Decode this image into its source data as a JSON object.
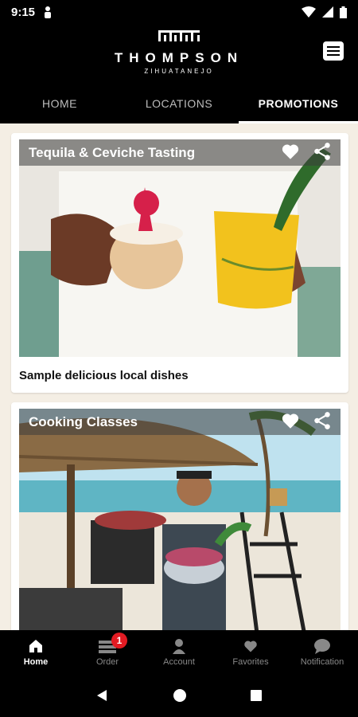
{
  "status": {
    "time": "9:15"
  },
  "header": {
    "logo_mark": "ꞌ⊓⊓ꞌ⊓⊓",
    "brand": "THOMPSON",
    "location": "ZIHUATANEJO",
    "menu_icon": "list-icon"
  },
  "tabs": [
    {
      "label": "HOME"
    },
    {
      "label": "LOCATIONS"
    },
    {
      "label": "PROMOTIONS"
    }
  ],
  "cards": [
    {
      "title": "Tequila & Ceviche Tasting",
      "description": "Sample delicious local dishes"
    },
    {
      "title": "Cooking Classes",
      "description": ""
    }
  ],
  "bottom_nav": [
    {
      "label": "Home",
      "icon": "home-icon"
    },
    {
      "label": "Order",
      "icon": "tray-icon",
      "badge": "1"
    },
    {
      "label": "Account",
      "icon": "person-icon"
    },
    {
      "label": "Favorites",
      "icon": "heart-icon"
    },
    {
      "label": "Notification",
      "icon": "chat-bubble-icon"
    }
  ],
  "colors": {
    "accent_active": "#ffffff",
    "badge": "#e31b23",
    "background": "#f4eee4"
  }
}
